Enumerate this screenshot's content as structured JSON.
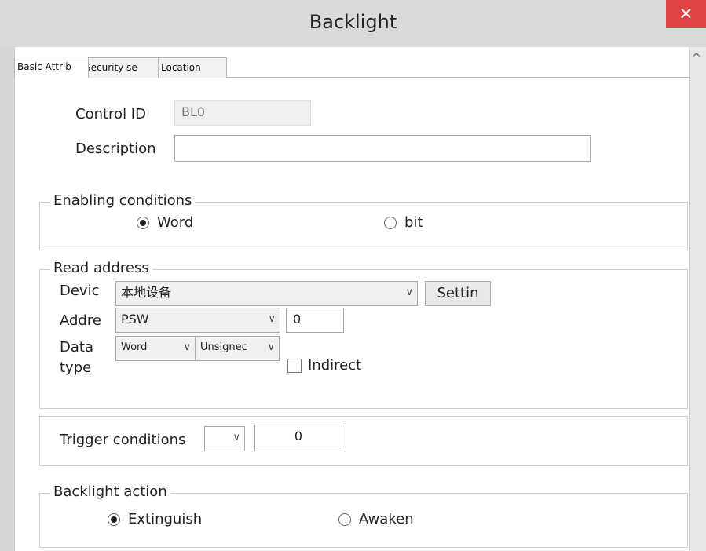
{
  "window": {
    "title": "Backlight",
    "close_glyph": "×"
  },
  "tabs": [
    {
      "label": "Basic Attrib"
    },
    {
      "label": "Security se"
    },
    {
      "label": "Location"
    }
  ],
  "form": {
    "control_id_label": "Control ID",
    "control_id_value": "BL0",
    "description_label": "Description",
    "description_value": ""
  },
  "enabling": {
    "legend": "Enabling conditions",
    "options": [
      {
        "label": "Word",
        "selected": true
      },
      {
        "label": "bit",
        "selected": false
      }
    ]
  },
  "read_address": {
    "legend": "Read address",
    "device_label": "Devic",
    "device_value": "本地设备",
    "settings_label": "Settin",
    "address_label": "Addre",
    "address_value": "PSW",
    "address_offset": "0",
    "data_type_label_1": "Data",
    "data_type_label_2": "type",
    "data_type_value": "Word",
    "sign_value": "Unsignec",
    "indirect_label": "Indirect",
    "indirect_checked": false
  },
  "trigger": {
    "label": "Trigger conditions",
    "value": "0"
  },
  "backlight_action": {
    "legend": "Backlight action",
    "options": [
      {
        "label": "Extinguish",
        "selected": true
      },
      {
        "label": "Awaken",
        "selected": false
      }
    ]
  },
  "icons": {
    "dropdown": "chevron-down-icon",
    "scroll": "scroll-up-icon",
    "close": "close-icon"
  }
}
